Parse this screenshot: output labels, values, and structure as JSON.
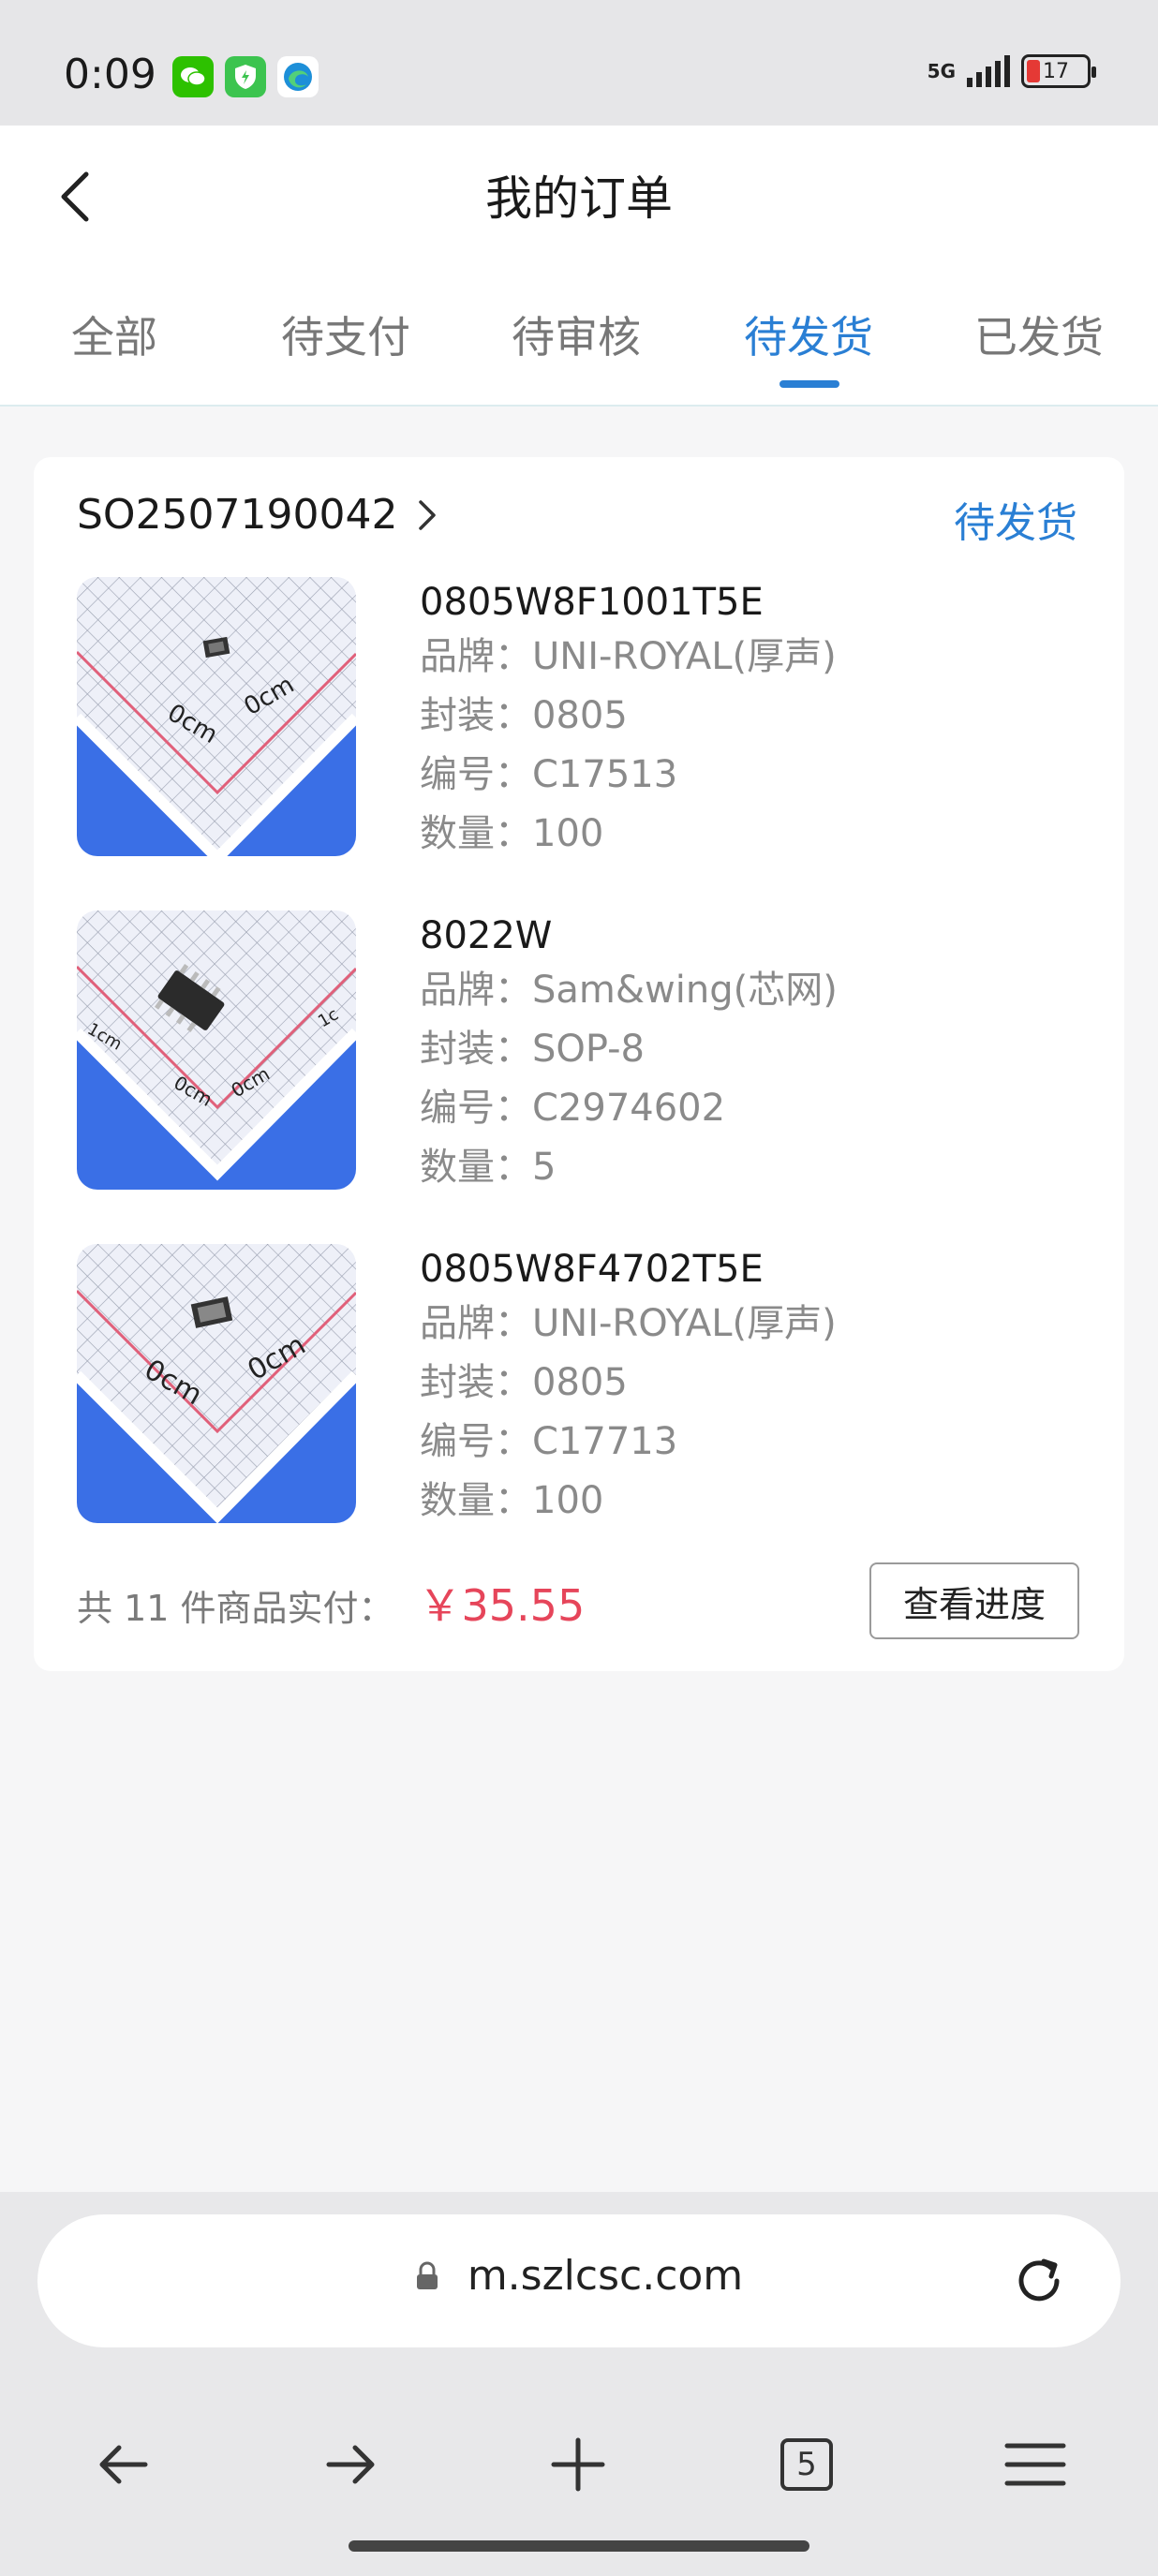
{
  "status_bar": {
    "time": "0:09",
    "network": "5G",
    "battery": "17",
    "battery_color": "#e53935"
  },
  "header": {
    "title": "我的订单"
  },
  "tabs": [
    {
      "label": "全部"
    },
    {
      "label": "待支付"
    },
    {
      "label": "待审核"
    },
    {
      "label": "待发货",
      "active": true
    },
    {
      "label": "已发货"
    }
  ],
  "order": {
    "number": "SO2507190042",
    "status": "待发货",
    "items": [
      {
        "name": "0805W8F1001T5E",
        "brand": "品牌：UNI-ROYAL(厚声)",
        "package": "封装：0805",
        "code": "编号：C17513",
        "qty": "数量：100"
      },
      {
        "name": "8022W",
        "brand": "品牌：Sam&wing(芯网)",
        "package": "封装：SOP-8",
        "code": "编号：C2974602",
        "qty": "数量：5"
      },
      {
        "name": "0805W8F4702T5E",
        "brand": "品牌：UNI-ROYAL(厚声)",
        "package": "封装：0805",
        "code": "编号：C17713",
        "qty": "数量：100"
      }
    ],
    "summary_text": "共 11 件商品实付：",
    "total": "￥35.55",
    "progress_button": "查看进度"
  },
  "browser": {
    "url": "m.szlcsc.com",
    "tab_count": "5"
  },
  "colors": {
    "accent": "#2a7fd4",
    "price": "#e6455a"
  }
}
